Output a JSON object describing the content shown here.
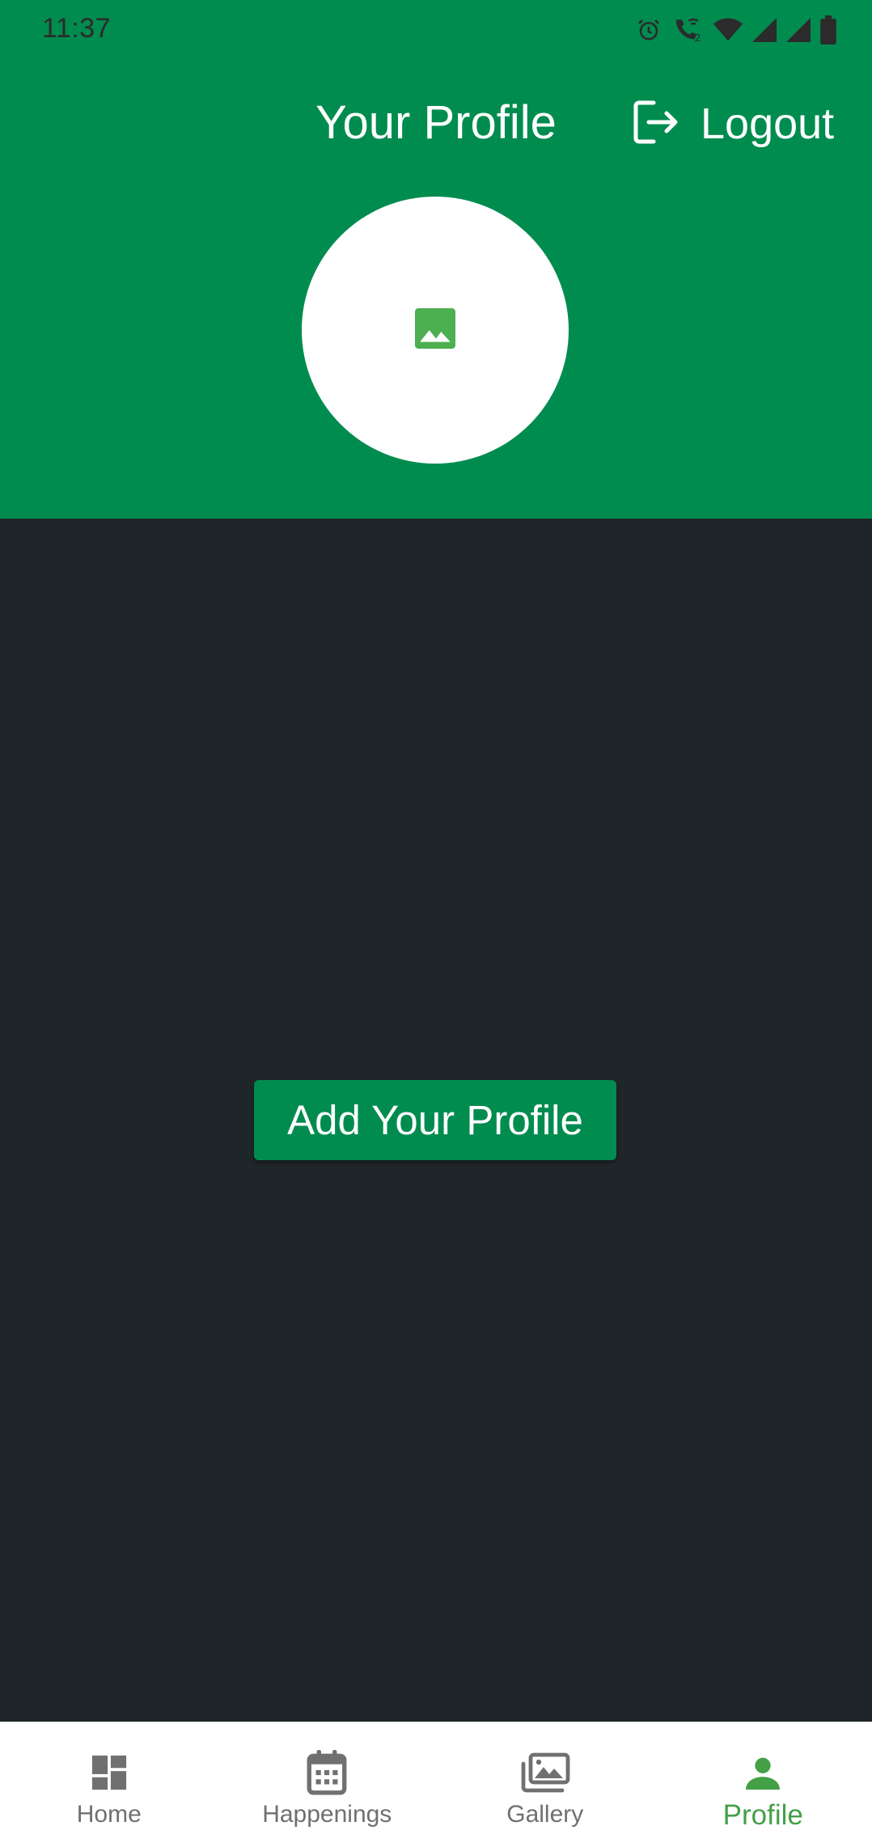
{
  "status_bar": {
    "time": "11:37"
  },
  "header": {
    "title": "Your Profile",
    "logout_label": "Logout",
    "background_color": "#008c4f",
    "avatar_icon": "image-placeholder-icon"
  },
  "main": {
    "add_profile_label": "Add Your Profile",
    "background_color": "#1f2629"
  },
  "bottom_nav": {
    "items": [
      {
        "label": "Home",
        "icon": "dashboard-icon",
        "active": false
      },
      {
        "label": "Happenings",
        "icon": "calendar-icon",
        "active": false
      },
      {
        "label": "Gallery",
        "icon": "photo-library-icon",
        "active": false
      },
      {
        "label": "Profile",
        "icon": "person-icon",
        "active": true
      }
    ],
    "active_color": "#43a047",
    "inactive_color": "#707070"
  }
}
